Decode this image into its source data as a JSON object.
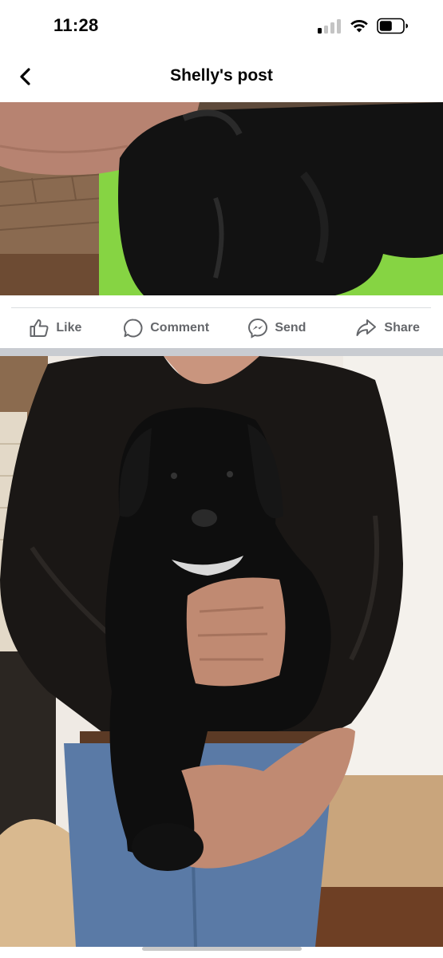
{
  "status_bar": {
    "time": "11:28",
    "signal_icon": "cellular-signal-icon",
    "wifi_icon": "wifi-icon",
    "battery_icon": "battery-icon",
    "battery_level": 0.5
  },
  "header": {
    "title": "Shelly's post",
    "back_icon": "chevron-left-icon"
  },
  "actions": [
    {
      "label": "Like",
      "icon": "thumbs-up-icon"
    },
    {
      "label": "Comment",
      "icon": "comment-bubble-icon"
    },
    {
      "label": "Send",
      "icon": "messenger-icon"
    },
    {
      "label": "Share",
      "icon": "share-arrow-icon"
    }
  ],
  "photos": [
    {
      "description_icon": "photo-puppy-cropped"
    },
    {
      "description_icon": "photo-man-holding-puppy"
    }
  ],
  "colors": {
    "icon_gray": "#65676b",
    "divider": "#dadde1",
    "section_separator": "#c9ccd1"
  }
}
